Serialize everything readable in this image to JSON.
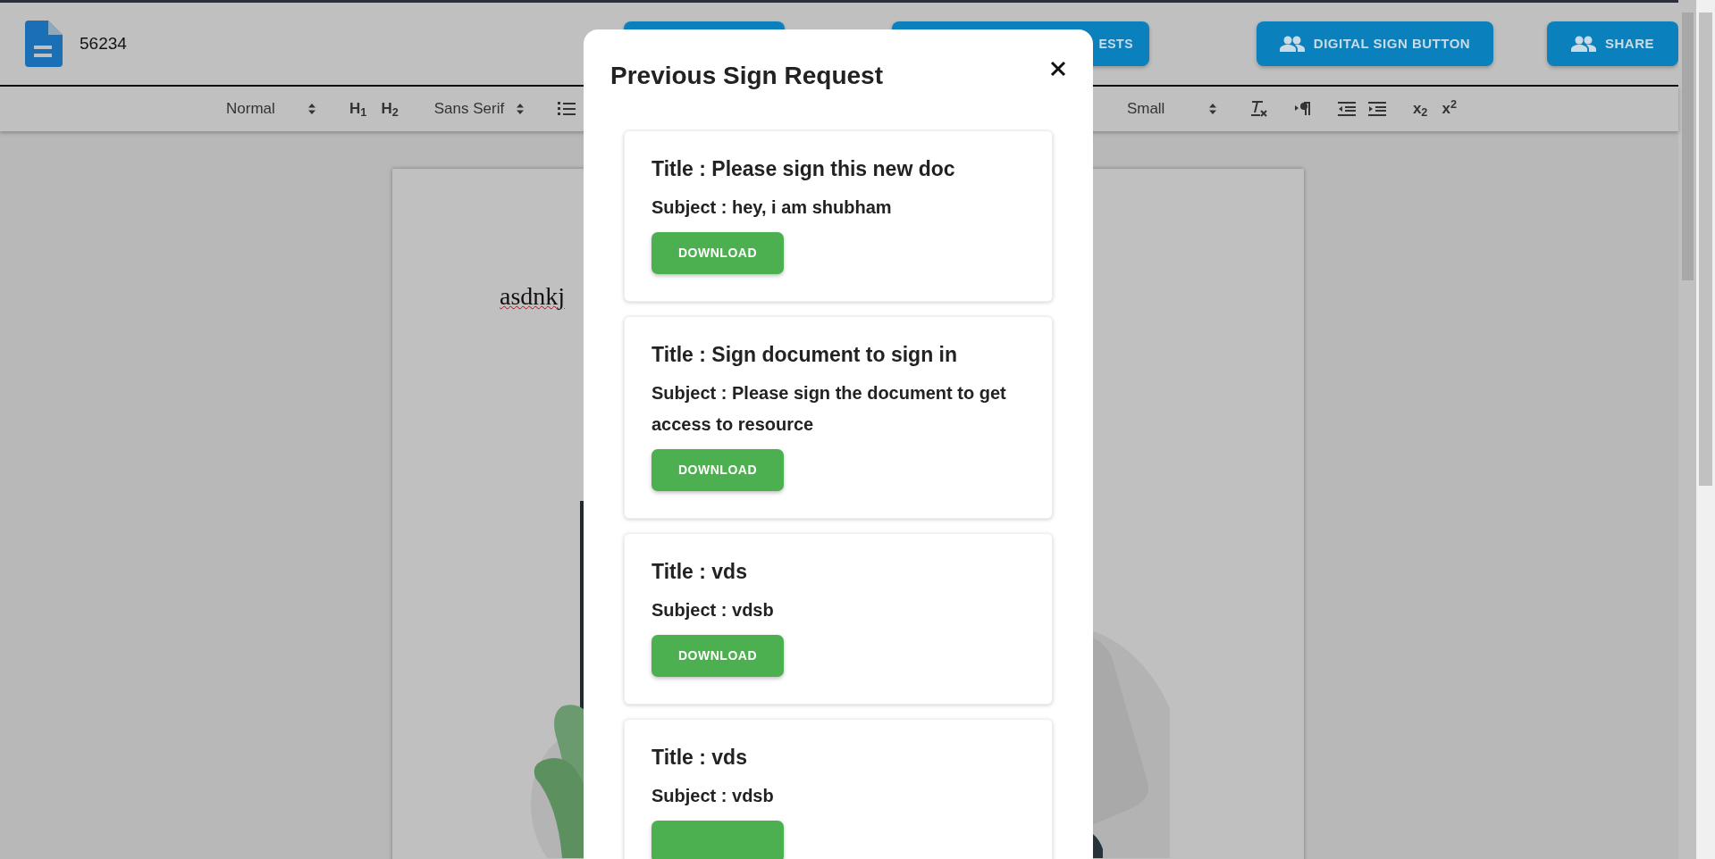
{
  "document": {
    "name": "56234",
    "text": "asdnkj"
  },
  "actions": [
    {
      "kind": "plain"
    },
    {
      "kind": "plain",
      "label": "ESTS"
    },
    {
      "kind": "icon",
      "label": "DIGITAL SIGN BUTTON"
    },
    {
      "kind": "icon",
      "label": "SHARE"
    }
  ],
  "toolbar_left": [
    {
      "kind": "select",
      "label": "Normal"
    },
    {
      "kind": "text",
      "label": "H$_{1}$"
    },
    {
      "kind": "text",
      "label": "H$_{2}$"
    },
    {
      "kind": "select",
      "label": "Sans Serif"
    },
    {
      "kind": "list"
    }
  ],
  "toolbar_right": [
    {
      "kind": "select",
      "label": "Small"
    },
    {
      "kind": "clean"
    },
    {
      "kind": "direction"
    },
    {
      "kind": "outdent"
    },
    {
      "kind": "indent"
    },
    {
      "kind": "text",
      "label": "x$_{2}$"
    },
    {
      "kind": "text",
      "label": "x$^{2}$"
    }
  ],
  "dialog": {
    "title": "Previous Sign Request",
    "requests": [
      {
        "title": "Title : Please sign this new doc",
        "subject": "Subject : hey, i am shubham",
        "button": "DOWNLOAD"
      },
      {
        "title": "Title : Sign document to sign in",
        "subject": "Subject : Please sign the document to get access to resource",
        "button": "DOWNLOAD"
      },
      {
        "title": "Title : vds",
        "subject": "Subject : vdsb",
        "button": "DOWNLOAD"
      },
      {
        "title": "Title : vds",
        "subject": "Subject : vdsb"
      }
    ]
  }
}
